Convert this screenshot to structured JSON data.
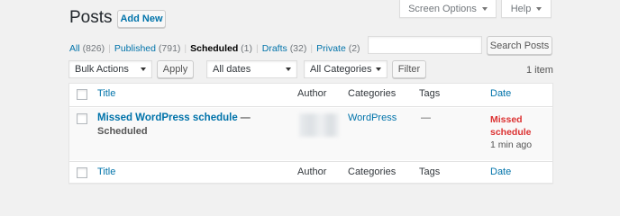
{
  "header": {
    "title": "Posts",
    "add_new": "Add New",
    "screen_options": "Screen Options",
    "help": "Help"
  },
  "filters": {
    "all_label": "All",
    "all_count": "(826)",
    "published_label": "Published",
    "published_count": "(791)",
    "scheduled_label": "Scheduled",
    "scheduled_count": "(1)",
    "drafts_label": "Drafts",
    "drafts_count": "(32)",
    "private_label": "Private",
    "private_count": "(2)",
    "separator": "|"
  },
  "search": {
    "value": "",
    "button": "Search Posts"
  },
  "toolbar": {
    "bulk_actions": "Bulk Actions",
    "apply": "Apply",
    "dates": "All dates",
    "categories": "All Categories",
    "filter": "Filter",
    "items_count": "1 item"
  },
  "columns": {
    "title": "Title",
    "author": "Author",
    "categories": "Categories",
    "tags": "Tags",
    "date": "Date"
  },
  "rows": [
    {
      "title": "Missed WordPress schedule",
      "title_suffix": "— Scheduled",
      "author": "",
      "category": "WordPress",
      "tags": "—",
      "date_status_line1": "Missed",
      "date_status_line2": "schedule",
      "date_time": "1 min ago"
    }
  ],
  "colors": {
    "link": "#0073aa",
    "missed": "#dc3232",
    "background": "#f1f1f1"
  }
}
